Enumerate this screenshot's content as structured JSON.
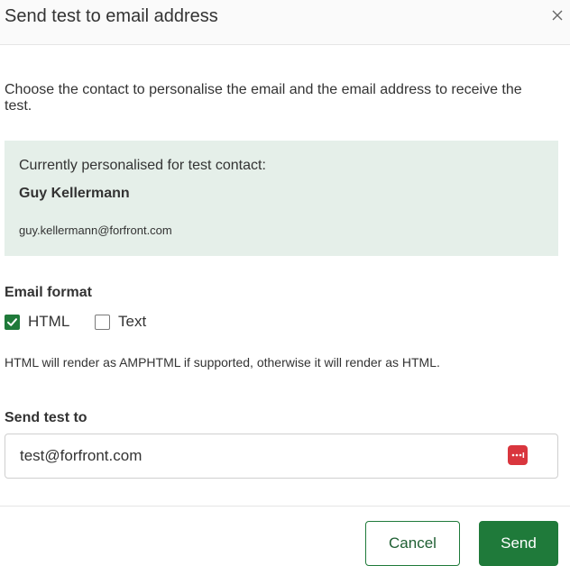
{
  "dialog": {
    "title": "Send test to email address",
    "close_icon": "close-icon"
  },
  "intro_text": "Choose the contact to personalise the email and the email address to receive the test.",
  "contact": {
    "caption": "Currently personalised for test contact:",
    "name": "Guy Kellermann",
    "email": "guy.kellermann@forfront.com"
  },
  "email_format": {
    "label": "Email format",
    "options": [
      {
        "label": "HTML",
        "checked": true
      },
      {
        "label": "Text",
        "checked": false
      }
    ],
    "note": "HTML will render as AMPHTML if supported, otherwise it will render as HTML."
  },
  "send_to": {
    "label": "Send test to",
    "value": "test@forfront.com",
    "field_icon": "password-manager-icon"
  },
  "buttons": {
    "cancel": "Cancel",
    "send": "Send"
  },
  "colors": {
    "accent": "#1f7a3a",
    "contact_box_bg": "#e5efe9",
    "header_bg": "#fafafa",
    "password_icon": "#d9363e"
  }
}
